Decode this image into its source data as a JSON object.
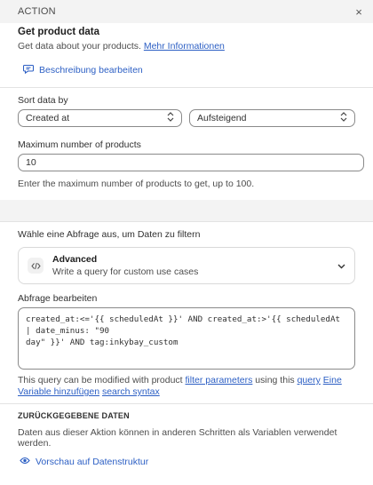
{
  "header": {
    "title": "ACTION",
    "close_label": "×"
  },
  "intro": {
    "title": "Get product data",
    "description": "Get data about your products.",
    "more_link": "Mehr Informationen",
    "edit_description": "Beschreibung bearbeiten"
  },
  "sort": {
    "label": "Sort data by",
    "field_value": "Created at",
    "order_value": "Aufsteigend"
  },
  "max": {
    "label": "Maximum number of products",
    "value": "10",
    "help": "Enter the maximum number of products to get, up to 100."
  },
  "query_select": {
    "label": "Wähle eine Abfrage aus, um Daten zu filtern",
    "title": "Advanced",
    "subtitle": "Write a query for custom use cases"
  },
  "query_edit": {
    "label": "Abfrage bearbeiten",
    "code": "created_at:<='{{ scheduledAt }}' AND created_at:>'{{ scheduledAt | date_minus: \"90\nday\" }}' AND tag:inkybay_custom",
    "help_prefix": "This query can be modified with product ",
    "filter_link": "filter parameters",
    "help_mid": " using this ",
    "query_link": "query",
    "var_link": "Eine Variable hinzufügen",
    "syntax_link": "search syntax"
  },
  "returned": {
    "heading": "ZURÜCKGEGEBENE DATEN",
    "desc": "Daten aus dieser Aktion können in anderen Schritten als Variablen verwendet werden.",
    "preview_link": "Vorschau auf Datenstruktur"
  },
  "colors": {
    "link": "#2c5fc4",
    "border": "#8a8a8a",
    "background": "#f3f3f3"
  }
}
